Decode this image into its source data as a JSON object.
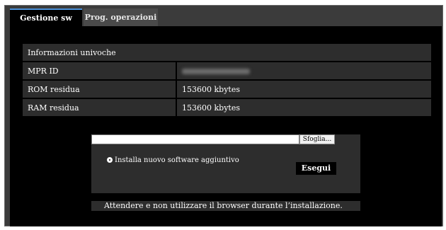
{
  "tabs": [
    {
      "label": "Gestione sw",
      "active": true
    },
    {
      "label": "Prog. operazioni",
      "active": false
    }
  ],
  "info": {
    "header": "Informazioni univoche",
    "rows": [
      {
        "label": "MPR ID",
        "value": ""
      },
      {
        "label": "ROM residua",
        "value": "153600 kbytes"
      },
      {
        "label": "RAM residua",
        "value": "153600 kbytes"
      }
    ]
  },
  "upload": {
    "file_value": "",
    "browse_label": "Sfoglia...",
    "radio_label": "Installa nuovo software aggiuntivo",
    "radio_selected": true,
    "execute_label": "Esegui"
  },
  "note": "Attendere e non utilizzare il browser durante l’installazione.",
  "colors": {
    "tab_accent": "#4a8fd8",
    "panel_bg": "#000000",
    "row_bg": "#2d2d2d"
  }
}
